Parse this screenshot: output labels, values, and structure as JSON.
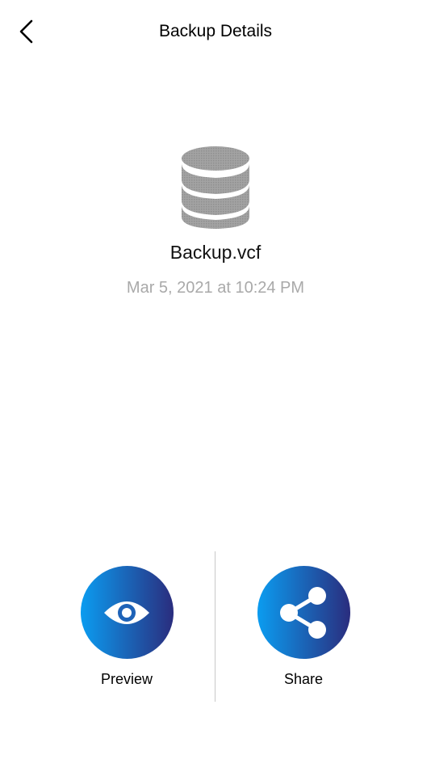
{
  "nav": {
    "title": "Backup Details",
    "back_icon": "chevron-left-icon"
  },
  "file": {
    "icon": "database-icon",
    "name": "Backup.vcf",
    "date": "Mar 5, 2021 at 10:24 PM"
  },
  "actions": [
    {
      "label": "Preview",
      "icon": "eye-icon"
    },
    {
      "label": "Share",
      "icon": "share-icon"
    }
  ],
  "colors": {
    "gradient_start": "#0b9cf0",
    "gradient_end": "#2a2d7e",
    "icon_gray": "#9a9a9a",
    "date_gray": "#a9a9a9",
    "divider": "#c8c8c8"
  }
}
